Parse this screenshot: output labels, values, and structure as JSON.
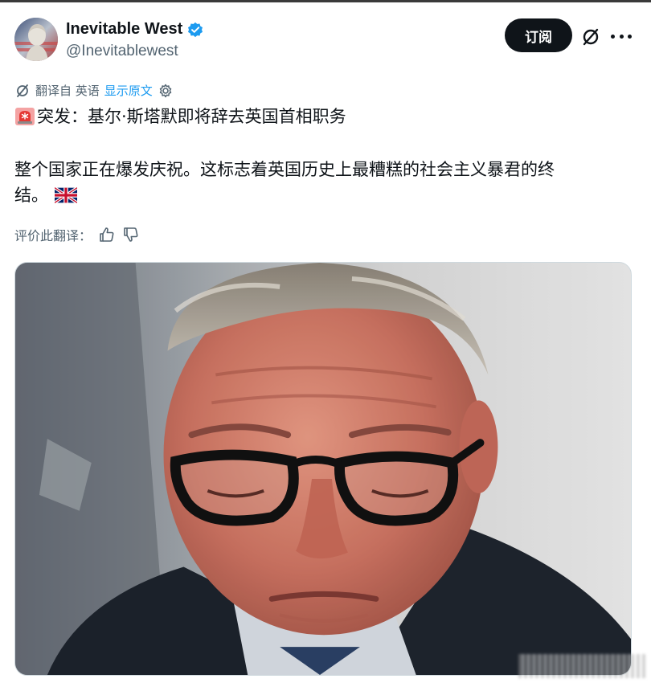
{
  "author": {
    "display_name": "Inevitable West",
    "handle": "@Inevitablewest",
    "verified": true,
    "avatar": "bust-statue-avatar"
  },
  "actions": {
    "subscribe_label": "订阅",
    "grok_icon": "slashed-circle-icon",
    "more_icon": "more-icon"
  },
  "translation": {
    "translated_from": "翻译自 英语",
    "show_original": "显示原文",
    "rate_label": "评价此翻译："
  },
  "post": {
    "line1": "突发：基尔·斯塔默即将辞去英国首相职务",
    "line2": "整个国家正在爆发庆祝。这标志着英国历史上最糟糕的社会主义暴君的终",
    "line3": "结。"
  },
  "media": {
    "type": "photo",
    "subject": "man-with-glasses-looking-down"
  },
  "colors": {
    "text": "#0f1419",
    "secondary": "#536471",
    "link": "#1d9bf0",
    "button": "#0f1419"
  }
}
